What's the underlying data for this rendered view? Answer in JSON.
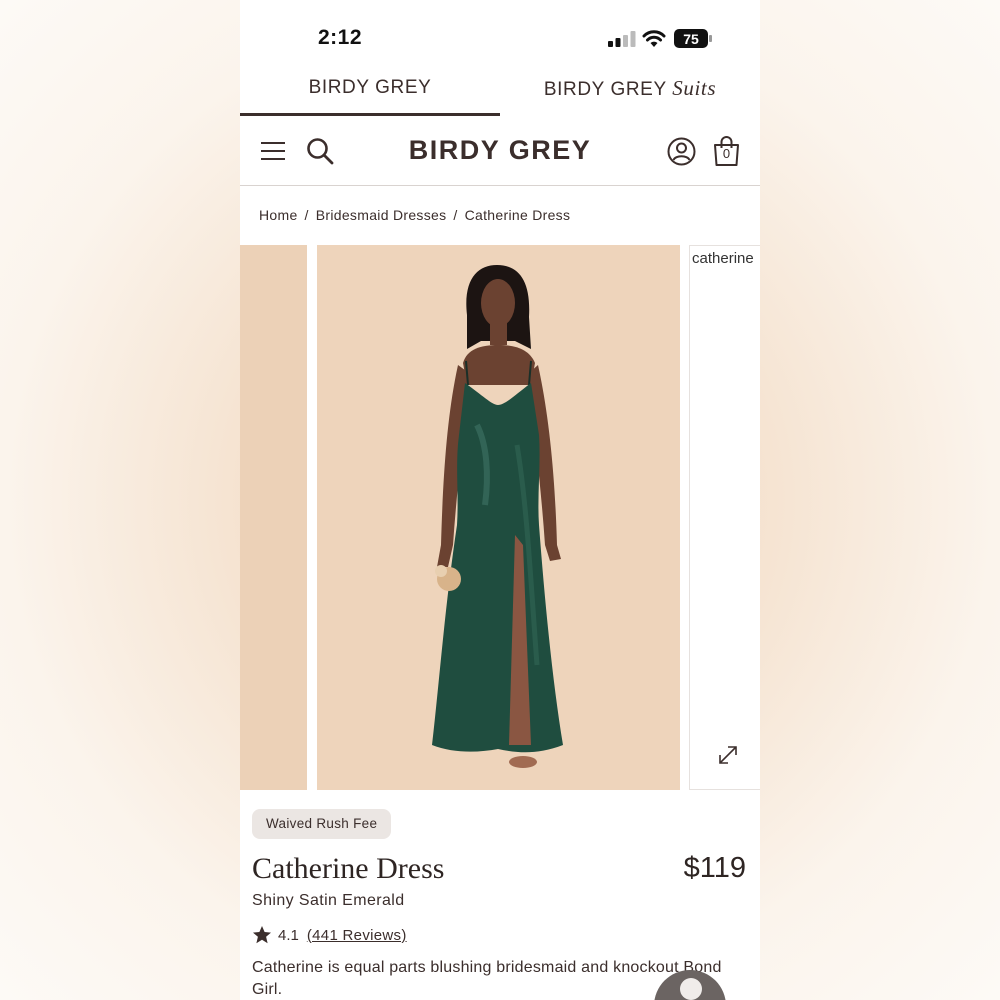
{
  "status_bar": {
    "time": "2:12",
    "battery": "75"
  },
  "brand_tabs": [
    {
      "label": "BIRDY GREY",
      "suffix": ""
    },
    {
      "label": "BIRDY GREY",
      "suffix": "Suits"
    }
  ],
  "header": {
    "logo": "BIRDY GREY",
    "cart_count": "0"
  },
  "breadcrumb": [
    {
      "label": "Home"
    },
    {
      "label": "Bridesmaid Dresses"
    },
    {
      "label": "Catherine Dress"
    }
  ],
  "breadcrumb_separator": "/",
  "gallery": {
    "next_image_alt": "catherine"
  },
  "product": {
    "badge": "Waived Rush Fee",
    "name": "Catherine Dress",
    "price": "$119",
    "color": "Shiny Satin Emerald",
    "rating": "4.1",
    "reviews": "(441 Reviews)",
    "description": "Catherine is equal parts blushing bridesmaid and knockout Bond Girl."
  },
  "colors": {
    "text": "#3b2e2c",
    "dress": "#1f4d3f",
    "backdrop": "#eed4bb"
  }
}
